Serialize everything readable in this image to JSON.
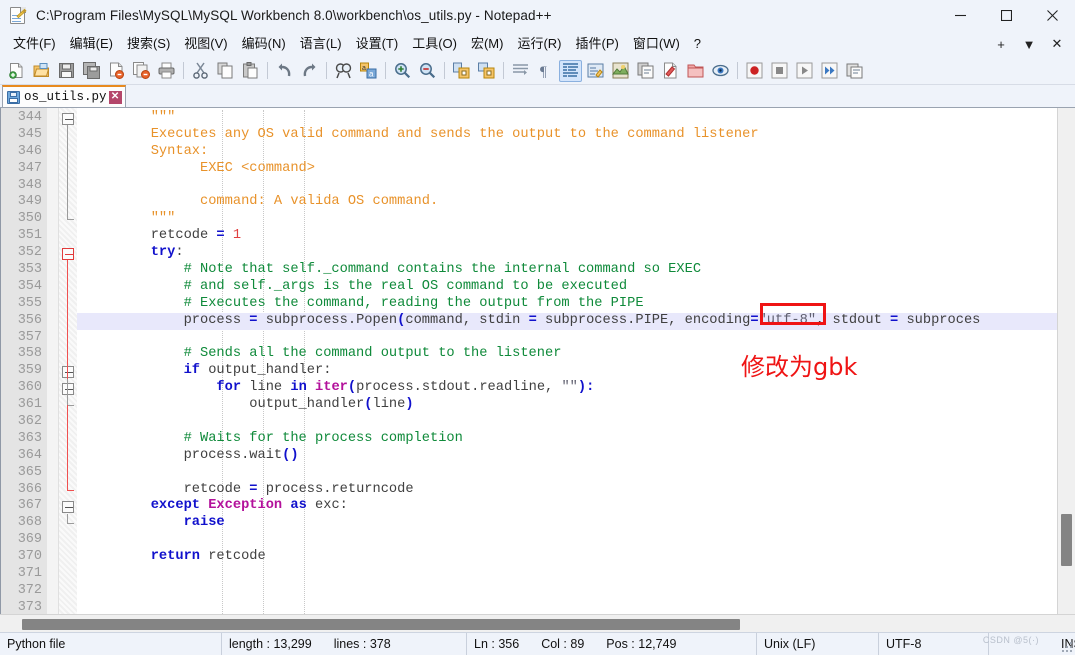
{
  "window": {
    "title": "C:\\Program Files\\MySQL\\MySQL Workbench 8.0\\workbench\\os_utils.py - Notepad++",
    "icon": "notepad-plus-plus-icon",
    "controls": {
      "minimize": "—",
      "maximize": "□",
      "close": "✕"
    }
  },
  "menubar": {
    "items": [
      {
        "label": "文件(F)",
        "name": "menu-file"
      },
      {
        "label": "编辑(E)",
        "name": "menu-edit"
      },
      {
        "label": "搜索(S)",
        "name": "menu-search"
      },
      {
        "label": "视图(V)",
        "name": "menu-view"
      },
      {
        "label": "编码(N)",
        "name": "menu-encoding"
      },
      {
        "label": "语言(L)",
        "name": "menu-language"
      },
      {
        "label": "设置(T)",
        "name": "menu-settings"
      },
      {
        "label": "工具(O)",
        "name": "menu-tools"
      },
      {
        "label": "宏(M)",
        "name": "menu-macro"
      },
      {
        "label": "运行(R)",
        "name": "menu-run"
      },
      {
        "label": "插件(P)",
        "name": "menu-plugins"
      },
      {
        "label": "窗口(W)",
        "name": "menu-window"
      },
      {
        "label": "?",
        "name": "menu-help"
      }
    ],
    "right": [
      {
        "label": "+",
        "name": "menu-add-tab-button"
      },
      {
        "label": "▼",
        "name": "menu-tab-list-button"
      },
      {
        "label": "✕",
        "name": "menu-close-tab-button"
      }
    ]
  },
  "toolbar": {
    "buttons": [
      {
        "name": "new-file-icon",
        "tip": "New"
      },
      {
        "name": "open-file-icon",
        "tip": "Open"
      },
      {
        "name": "save-icon",
        "tip": "Save"
      },
      {
        "name": "save-all-icon",
        "tip": "Save All"
      },
      {
        "name": "close-file-icon",
        "tip": "Close"
      },
      {
        "name": "close-all-files-icon",
        "tip": "Close All"
      },
      {
        "name": "print-icon",
        "tip": "Print"
      },
      {
        "name": "separator-1",
        "tip": ""
      },
      {
        "name": "cut-icon",
        "tip": "Cut"
      },
      {
        "name": "copy-icon",
        "tip": "Copy"
      },
      {
        "name": "paste-icon",
        "tip": "Paste"
      },
      {
        "name": "separator-2",
        "tip": ""
      },
      {
        "name": "undo-icon",
        "tip": "Undo"
      },
      {
        "name": "redo-icon",
        "tip": "Redo"
      },
      {
        "name": "separator-3",
        "tip": ""
      },
      {
        "name": "find-icon",
        "tip": "Find"
      },
      {
        "name": "replace-icon",
        "tip": "Replace"
      },
      {
        "name": "separator-4",
        "tip": ""
      },
      {
        "name": "zoom-in-icon",
        "tip": "Zoom In"
      },
      {
        "name": "zoom-out-icon",
        "tip": "Zoom Out"
      },
      {
        "name": "separator-5",
        "tip": ""
      },
      {
        "name": "sync-vertical-scroll-icon",
        "tip": "Sync Vertical Scrolling"
      },
      {
        "name": "sync-horizontal-scroll-icon",
        "tip": "Sync Horizontal Scrolling"
      },
      {
        "name": "separator-6",
        "tip": ""
      },
      {
        "name": "word-wrap-icon",
        "tip": "Word Wrap"
      },
      {
        "name": "show-all-characters-icon",
        "tip": "Show All Characters"
      },
      {
        "name": "indent-guide-icon",
        "tip": "Show Indent Guide"
      },
      {
        "name": "user-defined-language-icon",
        "tip": "User-Defined Dialogue"
      },
      {
        "name": "document-map-icon",
        "tip": "Document Map"
      },
      {
        "name": "function-list-icon",
        "tip": "Function List"
      },
      {
        "name": "document-switcher-icon",
        "tip": "Document Switcher"
      },
      {
        "name": "folder-as-workspace-icon",
        "tip": "Folder as Workspace"
      },
      {
        "name": "monitoring-icon",
        "tip": "Monitoring (tail -f)"
      },
      {
        "name": "separator-7",
        "tip": ""
      },
      {
        "name": "macro-record-icon",
        "tip": "Start Recording"
      },
      {
        "name": "macro-stop-icon",
        "tip": "Stop Recording"
      },
      {
        "name": "macro-play-icon",
        "tip": "Playback"
      },
      {
        "name": "macro-run-multiple-icon",
        "tip": "Run a Macro Multiple Times"
      },
      {
        "name": "macro-save-icon",
        "tip": "Save Current Recorded Macro"
      }
    ]
  },
  "tabs": [
    {
      "label": "os_utils.py",
      "active": true,
      "modified": false,
      "close": "✕"
    }
  ],
  "editor": {
    "first_line": 344,
    "current_line": 356,
    "lines": [
      {
        "n": 344,
        "tokens": [
          {
            "t": "str",
            "v": "        \"\"\""
          }
        ]
      },
      {
        "n": 345,
        "tokens": [
          {
            "t": "str",
            "v": "        Executes any OS valid command and sends the output to the command listener"
          }
        ]
      },
      {
        "n": 346,
        "tokens": [
          {
            "t": "str",
            "v": "        Syntax:"
          }
        ]
      },
      {
        "n": 347,
        "tokens": [
          {
            "t": "str",
            "v": "              EXEC <command>"
          }
        ]
      },
      {
        "n": 348,
        "tokens": [
          {
            "t": "txt",
            "v": ""
          }
        ]
      },
      {
        "n": 349,
        "tokens": [
          {
            "t": "str",
            "v": "              command: A valida OS command."
          }
        ]
      },
      {
        "n": 350,
        "tokens": [
          {
            "t": "str",
            "v": "        \"\"\""
          }
        ]
      },
      {
        "n": 351,
        "tokens": [
          {
            "t": "txt",
            "v": "        retcode "
          },
          {
            "t": "op",
            "v": "="
          },
          {
            "t": "txt",
            "v": " "
          },
          {
            "t": "num",
            "v": "1"
          }
        ]
      },
      {
        "n": 352,
        "tokens": [
          {
            "t": "kw",
            "v": "        try"
          },
          {
            "t": "txt",
            "v": ":"
          }
        ]
      },
      {
        "n": 353,
        "tokens": [
          {
            "t": "cmt",
            "v": "            # Note that self._command contains the internal command so EXEC"
          }
        ]
      },
      {
        "n": 354,
        "tokens": [
          {
            "t": "cmt",
            "v": "            # and self._args is the real OS command to be executed"
          }
        ]
      },
      {
        "n": 355,
        "tokens": [
          {
            "t": "cmt",
            "v": "            # Executes the command, reading the output from the PIPE"
          }
        ]
      },
      {
        "n": 356,
        "tokens": [
          {
            "t": "txt",
            "v": "            process "
          },
          {
            "t": "op",
            "v": "="
          },
          {
            "t": "txt",
            "v": " subprocess.Popen"
          },
          {
            "t": "pn",
            "v": "("
          },
          {
            "t": "txt",
            "v": "command, stdin "
          },
          {
            "t": "op",
            "v": "="
          },
          {
            "t": "txt",
            "v": " subprocess.PIPE, encoding"
          },
          {
            "t": "op",
            "v": "="
          },
          {
            "t": "qs",
            "v": "\"utf-8\""
          },
          {
            "t": "txt",
            "v": ", stdout "
          },
          {
            "t": "op",
            "v": "="
          },
          {
            "t": "txt",
            "v": " subproces"
          }
        ]
      },
      {
        "n": 357,
        "tokens": [
          {
            "t": "txt",
            "v": ""
          }
        ]
      },
      {
        "n": 358,
        "tokens": [
          {
            "t": "cmt",
            "v": "            # Sends all the command output to the listener"
          }
        ]
      },
      {
        "n": 359,
        "tokens": [
          {
            "t": "kw",
            "v": "            if"
          },
          {
            "t": "txt",
            "v": " output_handler:"
          }
        ]
      },
      {
        "n": 360,
        "tokens": [
          {
            "t": "kw",
            "v": "                for"
          },
          {
            "t": "txt",
            "v": " line "
          },
          {
            "t": "kw",
            "v": "in"
          },
          {
            "t": "txt",
            "v": " "
          },
          {
            "t": "bi",
            "v": "iter"
          },
          {
            "t": "pn",
            "v": "("
          },
          {
            "t": "txt",
            "v": "process.stdout.readline, "
          },
          {
            "t": "qs",
            "v": "\"\""
          },
          {
            "t": "pn",
            "v": "):"
          }
        ]
      },
      {
        "n": 361,
        "tokens": [
          {
            "t": "txt",
            "v": "                    output_handler"
          },
          {
            "t": "pn",
            "v": "("
          },
          {
            "t": "txt",
            "v": "line"
          },
          {
            "t": "pn",
            "v": ")"
          }
        ]
      },
      {
        "n": 362,
        "tokens": [
          {
            "t": "txt",
            "v": ""
          }
        ]
      },
      {
        "n": 363,
        "tokens": [
          {
            "t": "cmt",
            "v": "            # Waits for the process completion"
          }
        ]
      },
      {
        "n": 364,
        "tokens": [
          {
            "t": "txt",
            "v": "            process.wait"
          },
          {
            "t": "pn",
            "v": "()"
          }
        ]
      },
      {
        "n": 365,
        "tokens": [
          {
            "t": "txt",
            "v": ""
          }
        ]
      },
      {
        "n": 366,
        "tokens": [
          {
            "t": "txt",
            "v": "            retcode "
          },
          {
            "t": "op",
            "v": "="
          },
          {
            "t": "txt",
            "v": " process.returncode"
          }
        ]
      },
      {
        "n": 367,
        "tokens": [
          {
            "t": "kw",
            "v": "        except "
          },
          {
            "t": "bi",
            "v": "Exception"
          },
          {
            "t": "txt",
            "v": " "
          },
          {
            "t": "kw",
            "v": "as"
          },
          {
            "t": "txt",
            "v": " exc:"
          }
        ]
      },
      {
        "n": 368,
        "tokens": [
          {
            "t": "kw",
            "v": "            raise"
          }
        ]
      },
      {
        "n": 369,
        "tokens": [
          {
            "t": "txt",
            "v": ""
          }
        ]
      },
      {
        "n": 370,
        "tokens": [
          {
            "t": "kw",
            "v": "        return"
          },
          {
            "t": "txt",
            "v": " retcode"
          }
        ]
      },
      {
        "n": 371,
        "tokens": [
          {
            "t": "txt",
            "v": ""
          }
        ]
      },
      {
        "n": 372,
        "tokens": [
          {
            "t": "txt",
            "v": ""
          }
        ]
      },
      {
        "n": 373,
        "tokens": [
          {
            "t": "txt",
            "v": ""
          }
        ]
      }
    ],
    "fold_markers": [
      {
        "line": 344,
        "type": "box",
        "color": "grey"
      },
      {
        "line": 350,
        "type": "tail",
        "color": "grey"
      },
      {
        "line": 352,
        "type": "box",
        "color": "red"
      },
      {
        "line": 359,
        "type": "box",
        "color": "grey"
      },
      {
        "line": 360,
        "type": "box",
        "color": "grey"
      },
      {
        "line": 361,
        "type": "tail",
        "color": "grey"
      },
      {
        "line": 366,
        "type": "tail",
        "color": "red"
      },
      {
        "line": 367,
        "type": "box",
        "color": "grey"
      },
      {
        "line": 368,
        "type": "tail",
        "color": "grey"
      }
    ]
  },
  "annotations": {
    "highlight_box": {
      "target": "\"utf-8\"",
      "color": "#ef1414"
    },
    "note": {
      "text": "修改为gbk",
      "color": "#ef1414"
    }
  },
  "statusbar": {
    "language": "Python file",
    "length_label": "length : 13,299",
    "lines_label": "lines : 378",
    "ln": "Ln : 356",
    "col": "Col : 89",
    "pos": "Pos : 12,749",
    "eol": "Unix (LF)",
    "encoding": "UTF-8",
    "insert_mode": "INS",
    "watermark": "CSDN @5(·)"
  },
  "colors": {
    "string": "#e8922a",
    "comment": "#0f8a3a",
    "keyword": "#1111cc",
    "builtin": "#b3119b",
    "number": "#e04040",
    "annotation": "#ef1414",
    "current_line_bg": "#e8e8fb",
    "tab_accent": "#e88a1e"
  }
}
